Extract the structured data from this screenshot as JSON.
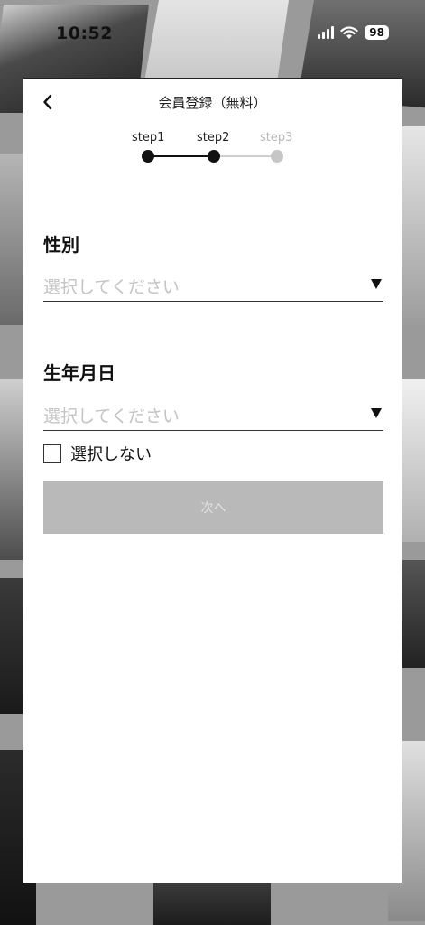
{
  "status_bar": {
    "time": "10:52",
    "battery": "98",
    "icons": [
      "signal-icon",
      "wifi-icon",
      "battery-icon"
    ]
  },
  "header": {
    "title": "会員登録（無料）",
    "back_icon": "chevron-left-icon"
  },
  "stepper": {
    "steps": [
      {
        "label": "step1",
        "state": "completed"
      },
      {
        "label": "step2",
        "state": "current"
      },
      {
        "label": "step3",
        "state": "upcoming"
      }
    ]
  },
  "gender": {
    "label": "性別",
    "placeholder": "選択してください",
    "arrow_icon": "triangle-down-icon"
  },
  "birthdate": {
    "label": "生年月日",
    "placeholder": "選択してください",
    "arrow_icon": "triangle-down-icon",
    "no_select_label": "選択しない",
    "no_select_checked": false
  },
  "next_button": {
    "label": "次へ",
    "enabled": false
  },
  "colors": {
    "background": "#9a9a9a",
    "card": "#ffffff",
    "active_step": "#111111",
    "inactive_step": "#c6c6c6",
    "disabled_button": "#b9b9b9"
  }
}
